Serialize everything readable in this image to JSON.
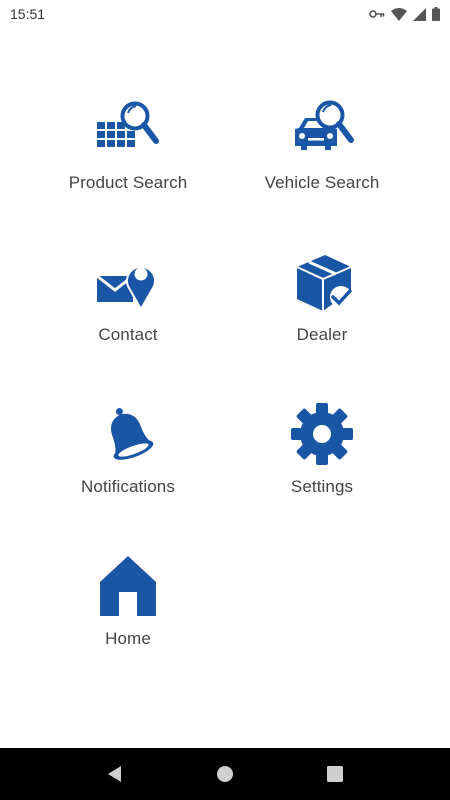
{
  "status_bar": {
    "time": "15:51",
    "icons": [
      "vpn-key-icon",
      "wifi-icon",
      "signal-icon",
      "battery-icon"
    ]
  },
  "colors": {
    "accent": "#1a56a6",
    "label": "#444444",
    "nav_bg": "#000000"
  },
  "menu": {
    "items": [
      {
        "label": "Product Search",
        "icon": "product-search-icon"
      },
      {
        "label": "Vehicle Search",
        "icon": "vehicle-search-icon"
      },
      {
        "label": "Contact",
        "icon": "contact-icon"
      },
      {
        "label": "Dealer",
        "icon": "dealer-box-icon"
      },
      {
        "label": "Notifications",
        "icon": "bell-icon"
      },
      {
        "label": "Settings",
        "icon": "gear-icon"
      },
      {
        "label": "Home",
        "icon": "home-icon"
      }
    ]
  },
  "nav_bar": {
    "buttons": [
      "back-icon",
      "home-circle-icon",
      "recents-square-icon"
    ]
  }
}
